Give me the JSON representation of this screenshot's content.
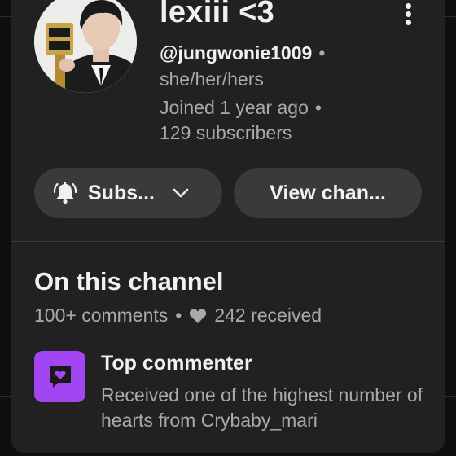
{
  "channel": {
    "name": "lexiii <3",
    "handle": "@jungwonie1009",
    "pronouns": "she/her/hers",
    "joined": "Joined 1 year ago",
    "subscribers": "129 subscribers",
    "separator": "•"
  },
  "actions": {
    "subscribe_label": "Subs...",
    "view_channel_label": "View chan...",
    "more_icon": "more-vert-icon",
    "bell_icon": "bell-icon",
    "chevron_icon": "chevron-down-icon"
  },
  "on_channel": {
    "title": "On this channel",
    "comments": "100+ comments",
    "separator": "•",
    "hearts_received": "242 received",
    "heart_icon": "heart-icon"
  },
  "badge": {
    "title": "Top commenter",
    "description": "Received one of the highest number of hearts from Crybaby_mari",
    "icon": "heart-message-icon",
    "color": "#a146f2"
  },
  "colors": {
    "page_bg": "#0f0f0f",
    "card_bg": "#212121",
    "pill_bg": "#3a3a3a",
    "primary_text": "#f1f1f1",
    "secondary_text": "#aaaaaa"
  }
}
